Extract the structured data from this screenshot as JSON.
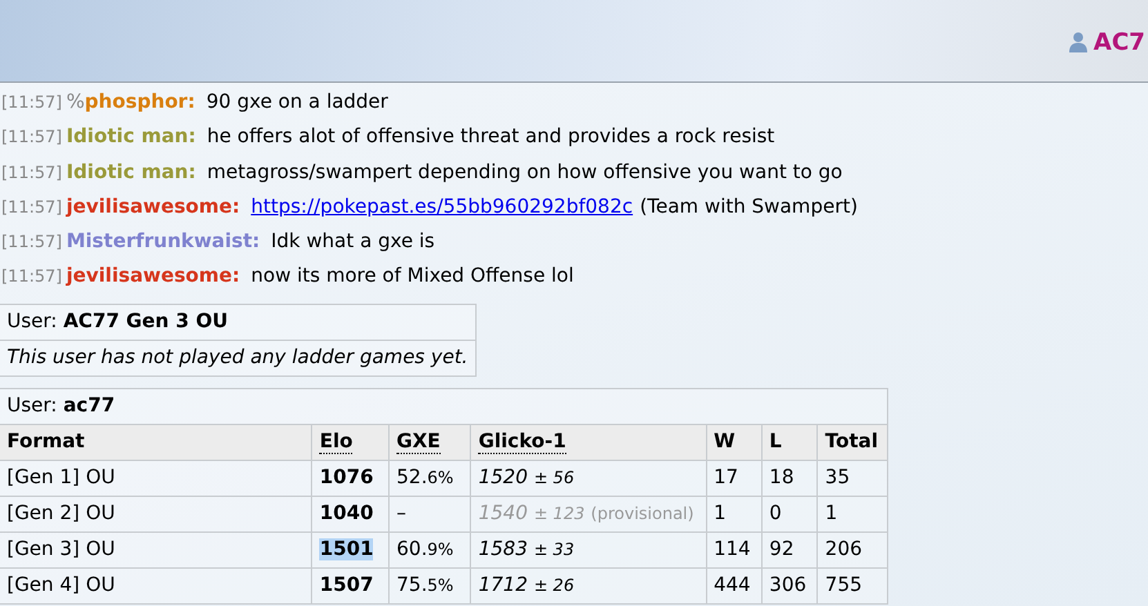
{
  "header": {
    "username": "AC7"
  },
  "messages": [
    {
      "time": "[11:57]",
      "rank": "%",
      "user": "phosphor:",
      "color": "#d97f0f",
      "parts": [
        {
          "kind": "text",
          "text": "90 gxe on a ladder"
        }
      ]
    },
    {
      "time": "[11:57]",
      "user": "Idiotic man:",
      "color": "#9a9a3a",
      "parts": [
        {
          "kind": "text",
          "text": "he offers alot of offensive threat and provides a rock resist"
        }
      ]
    },
    {
      "time": "[11:57]",
      "user": "Idiotic man:",
      "color": "#9a9a3a",
      "parts": [
        {
          "kind": "text",
          "text": "metagross/swampert depending on how offensive you want to go"
        }
      ]
    },
    {
      "time": "[11:57]",
      "user": "jevilisawesome:",
      "color": "#d6361c",
      "parts": [
        {
          "kind": "link",
          "text": "https://pokepast.es/55bb960292bf082c"
        },
        {
          "kind": "text",
          "text": "(Team with Swampert)"
        }
      ]
    },
    {
      "time": "[11:57]",
      "user": "Misterfrunkwaist:",
      "color": "#7f82cf",
      "parts": [
        {
          "kind": "text",
          "text": "Idk what a gxe is"
        }
      ]
    },
    {
      "time": "[11:57]",
      "user": "jevilisawesome:",
      "color": "#d6361c",
      "parts": [
        {
          "kind": "text",
          "text": "now its more of Mixed Offense lol"
        }
      ]
    }
  ],
  "ladder_empty": {
    "user_label": "User:",
    "user": "AC77 Gen 3 OU",
    "note": "This user has not played any ladder games yet."
  },
  "ladder": {
    "user_label": "User:",
    "user": "ac77",
    "columns": [
      "Format",
      "Elo",
      "GXE",
      "Glicko-1",
      "W",
      "L",
      "Total"
    ],
    "rows": [
      {
        "format": "[Gen 1] OU",
        "elo": "1076",
        "elo_selected": false,
        "gxe": "52.6%",
        "rating": "1520",
        "deviation": "± 56",
        "provisional": false,
        "w": "17",
        "l": "18",
        "total": "35"
      },
      {
        "format": "[Gen 2] OU",
        "elo": "1040",
        "elo_selected": false,
        "gxe": "–",
        "rating": "1540",
        "deviation": "± 123",
        "provisional": true,
        "note": "(provisional)",
        "w": "1",
        "l": "0",
        "total": "1"
      },
      {
        "format": "[Gen 3] OU",
        "elo": "1501",
        "elo_selected": true,
        "gxe": "60.9%",
        "rating": "1583",
        "deviation": "± 33",
        "provisional": false,
        "w": "114",
        "l": "92",
        "total": "206"
      },
      {
        "format": "[Gen 4] OU",
        "elo": "1507",
        "elo_selected": false,
        "gxe": "75.5%",
        "rating": "1712",
        "deviation": "± 26",
        "provisional": false,
        "w": "444",
        "l": "306",
        "total": "755"
      }
    ]
  }
}
